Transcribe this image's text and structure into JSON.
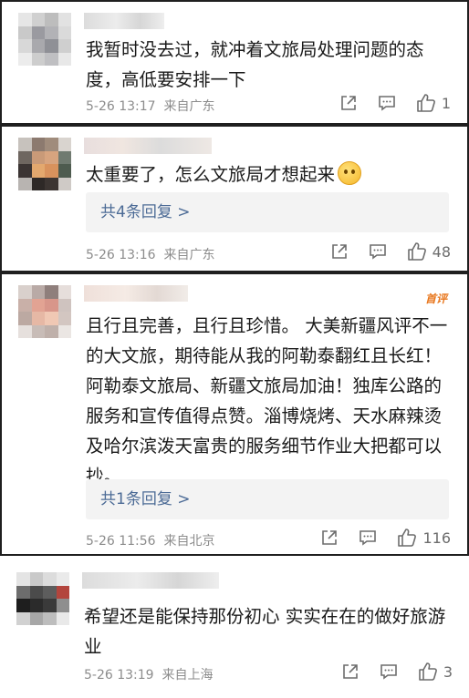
{
  "comments": [
    {
      "text": "我暂时没去过，就冲着文旅局处理问题的态度，高低要安排一下",
      "time": "5-26 13:17",
      "location": "来自广东",
      "likes": "1",
      "replies_label": "",
      "badge": ""
    },
    {
      "text": "太重要了，怎么文旅局才想起来",
      "time": "5-26 13:16",
      "location": "来自广东",
      "likes": "48",
      "replies_label": "共4条回复 >",
      "badge": ""
    },
    {
      "text": "且行且完善，且行且珍惜。 大美新疆风评不一的大文旅，期待能从我的阿勒泰翻红且长红！阿勒泰文旅局、新疆文旅局加油！独库公路的服务和宣传值得点赞。淄博烧烤、天水麻辣烫及哈尔滨泼天富贵的服务细节作业大把都可以抄。",
      "time": "5-26 11:56",
      "location": "来自北京",
      "likes": "116",
      "replies_label": "共1条回复 >",
      "badge": "首评"
    },
    {
      "text": "希望还是能保持那份初心 实实在在的做好旅游业",
      "time": "5-26 13:19",
      "location": "来自上海",
      "likes": "3",
      "replies_label": "",
      "badge": ""
    }
  ],
  "icons": {
    "share": "share-icon",
    "comment": "comment-icon",
    "like": "thumbs-up-icon",
    "emoji": "smiling-face-emoji-icon"
  },
  "colors": {
    "reply_link": "#4c6b96",
    "meta_text": "#8c8c8c",
    "reply_bg": "#f3f3f3",
    "badge": "#e8761c",
    "border": "#1f1f1f"
  }
}
